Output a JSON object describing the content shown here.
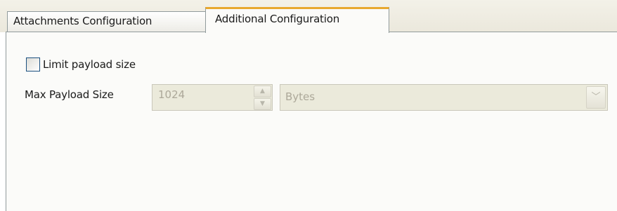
{
  "tabs": [
    {
      "label": "Attachments Configuration",
      "active": false
    },
    {
      "label": "Additional Configuration",
      "active": true
    }
  ],
  "limit_payload": {
    "label": "Limit payload size",
    "checked": false
  },
  "max_payload": {
    "label": "Max Payload Size",
    "value": "1024",
    "unit": "Bytes",
    "enabled": false
  },
  "icons": {
    "spinner_up": "chevron-up-icon",
    "spinner_down": "chevron-down-icon",
    "dropdown": "chevron-down-icon"
  },
  "colors": {
    "active_tab_accent": "#e8a82e",
    "disabled_text": "#aca899",
    "disabled_field_bg": "#ebeadb"
  }
}
